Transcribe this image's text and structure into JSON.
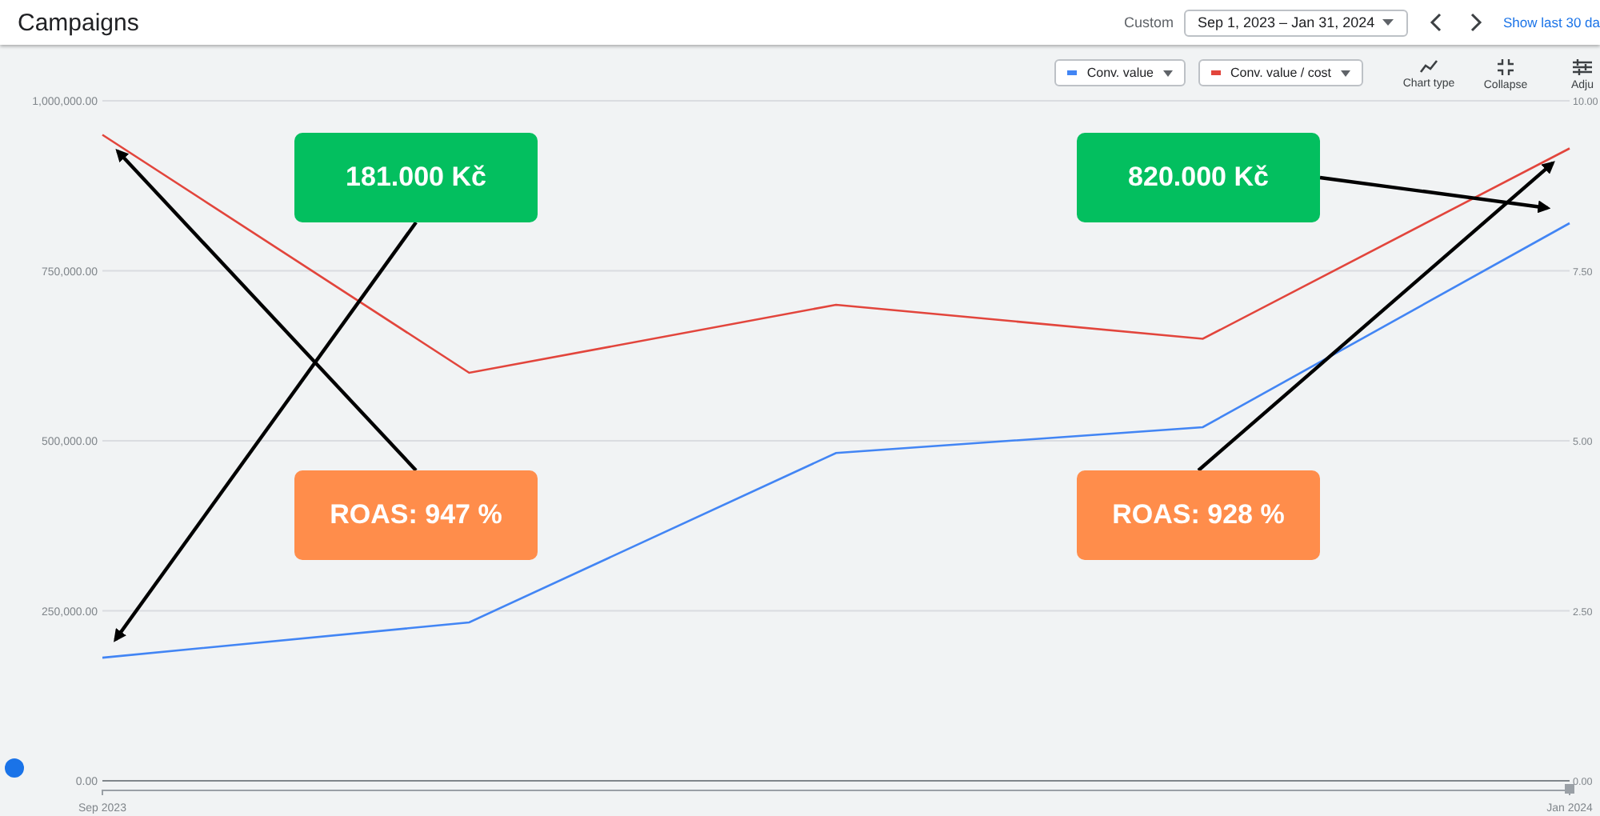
{
  "header": {
    "title": "Campaigns",
    "range_label": "Custom",
    "date_range": "Sep 1, 2023 – Jan 31, 2024",
    "show_last": "Show last 30 da"
  },
  "toolbar": {
    "actions": [
      {
        "kind": "chart",
        "label": "Chart type"
      },
      {
        "kind": "collapse",
        "label": "Collapse"
      },
      {
        "kind": "adjust",
        "label": "Adju"
      }
    ]
  },
  "chart_data": {
    "type": "line",
    "categories": [
      "Sep 2023",
      null,
      null,
      null,
      "Jan 2024"
    ],
    "ylim": [
      0,
      1000000
    ],
    "yticks": [
      {
        "value": 0,
        "label": "0.00"
      },
      {
        "value": 250000,
        "label": "250,000.00"
      },
      {
        "value": 500000,
        "label": "500,000.00"
      },
      {
        "value": 750000,
        "label": "750,000.00"
      },
      {
        "value": 1000000,
        "label": "1,000,000.00"
      }
    ],
    "y2lim": [
      0,
      10
    ],
    "y2ticks": [
      {
        "value": 0,
        "label": "0.00"
      },
      {
        "value": 2.5,
        "label": "2.50"
      },
      {
        "value": 5,
        "label": "5.00"
      },
      {
        "value": 7.5,
        "label": "7.50"
      },
      {
        "value": 10,
        "label": "10.00"
      }
    ],
    "series": [
      {
        "name": "Conv. value",
        "color": "#4285f4",
        "values": [
          181000,
          233000,
          482000,
          520000,
          820000
        ]
      },
      {
        "name": "Conv. value / cost",
        "color": "#e2453c",
        "axis": "y2",
        "values": [
          9.5,
          6.0,
          7.0,
          6.5,
          9.3
        ]
      }
    ],
    "grid": true
  },
  "callouts": [
    {
      "text": "181.000 Kč",
      "kind": "value"
    },
    {
      "text": "ROAS: 947 %",
      "kind": "roas"
    },
    {
      "text": "820.000 Kč",
      "kind": "value"
    },
    {
      "text": "ROAS: 928 %",
      "kind": "roas"
    }
  ]
}
